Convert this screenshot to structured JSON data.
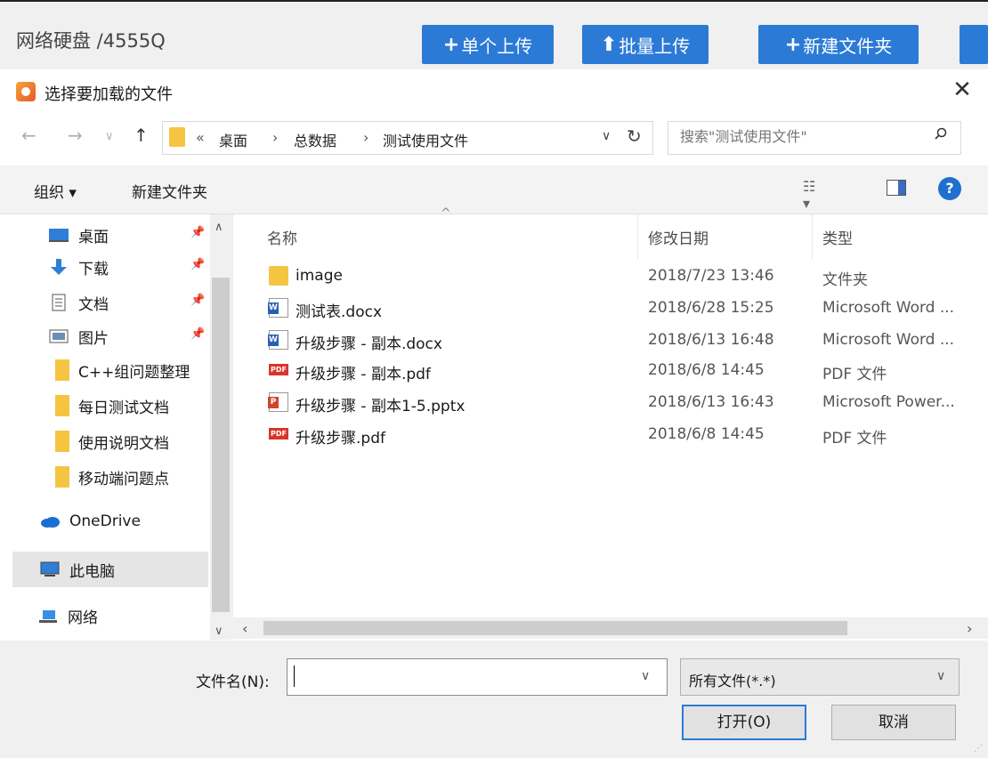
{
  "app": {
    "title": "网络硬盘 /4555Q",
    "buttons": [
      {
        "glyph": "+",
        "label": "单个上传"
      },
      {
        "glyph": "⬆",
        "label": "批量上传"
      },
      {
        "glyph": "+",
        "label": "新建文件夹"
      }
    ]
  },
  "dialog": {
    "title": "选择要加载的文件",
    "close": "✕",
    "breadcrumb": {
      "overflow": "«",
      "items": [
        "桌面",
        "总数据",
        "测试使用文件"
      ],
      "separator": "›"
    },
    "search_placeholder": "搜索\"测试使用文件\"",
    "toolbar": {
      "organize": "组织 ▾",
      "new_folder": "新建文件夹",
      "help": "?"
    },
    "nav": [
      {
        "label": "桌面",
        "icon": "desktop-icon",
        "pinned": true
      },
      {
        "label": "下载",
        "icon": "download-icon",
        "pinned": true
      },
      {
        "label": "文档",
        "icon": "document-icon",
        "pinned": true
      },
      {
        "label": "图片",
        "icon": "picture-icon",
        "pinned": true
      },
      {
        "label": "C++组问题整理",
        "icon": "folder-icon",
        "pinned": false
      },
      {
        "label": "每日测试文档",
        "icon": "folder-icon",
        "pinned": false
      },
      {
        "label": "使用说明文档",
        "icon": "folder-icon",
        "pinned": false
      },
      {
        "label": "移动端问题点",
        "icon": "folder-icon",
        "pinned": false
      },
      {
        "label": "OneDrive",
        "icon": "cloud-icon",
        "pinned": false
      },
      {
        "label": "此电脑",
        "icon": "computer-icon",
        "pinned": false,
        "selected": true
      },
      {
        "label": "网络",
        "icon": "network-icon",
        "pinned": false
      }
    ],
    "columns": {
      "name": "名称",
      "date": "修改日期",
      "type": "类型"
    },
    "files": [
      {
        "name": "image",
        "date": "2018/7/23 13:46",
        "type": "文件夹",
        "icon": "folder"
      },
      {
        "name": "测试表.docx",
        "date": "2018/6/28 15:25",
        "type": "Microsoft Word ...",
        "icon": "word"
      },
      {
        "name": "升级步骤 - 副本.docx",
        "date": "2018/6/13 16:48",
        "type": "Microsoft Word ...",
        "icon": "word"
      },
      {
        "name": "升级步骤 - 副本.pdf",
        "date": "2018/6/8 14:45",
        "type": "PDF 文件",
        "icon": "pdf"
      },
      {
        "name": "升级步骤 - 副本1-5.pptx",
        "date": "2018/6/13 16:43",
        "type": "Microsoft Power...",
        "icon": "ppt"
      },
      {
        "name": "升级步骤.pdf",
        "date": "2018/6/8 14:45",
        "type": "PDF 文件",
        "icon": "pdf"
      }
    ],
    "filename_label": "文件名(N):",
    "filename_value": "",
    "filetype": "所有文件(*.*)",
    "open": "打开(O)",
    "cancel": "取消"
  }
}
